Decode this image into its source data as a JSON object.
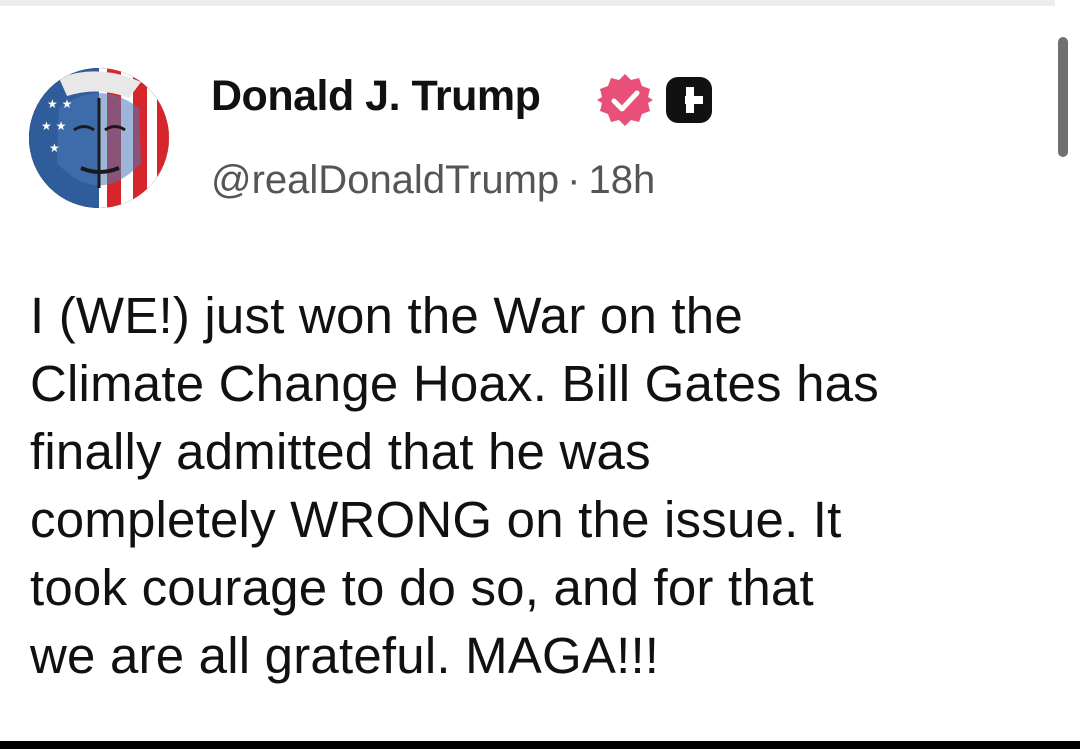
{
  "post": {
    "author": {
      "display_name": "Donald J. Trump",
      "handle": "@realDonaldTrump",
      "avatar": "flag-painted-portrait-avatar",
      "verified_icon": "verified-badge-icon",
      "badge_icon": "plus-badge-icon"
    },
    "separator": "·",
    "time_ago": "18h",
    "body_lines": [
      "I (WE!) just won the War on the",
      "Climate Change Hoax. Bill Gates has",
      "finally admitted that he was",
      "completely WRONG on the issue. It",
      "took courage to do so, and for that",
      "we are all grateful. MAGA!!!"
    ]
  },
  "colors": {
    "verified_badge": "#e8507a",
    "plus_badge": "#111111",
    "handle_text": "#555555",
    "body_text": "#111111",
    "scrollbar": "#707070"
  }
}
